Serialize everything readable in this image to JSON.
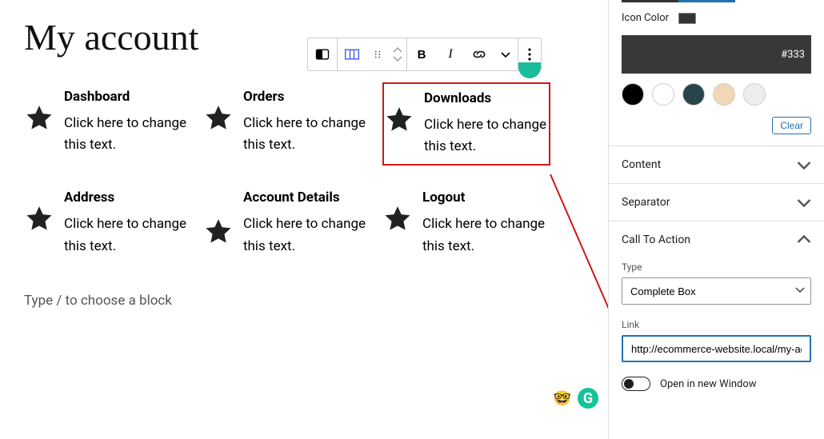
{
  "page": {
    "title": "My account",
    "block_prompt": "Type / to choose a block"
  },
  "toolbar": {
    "bold": "B",
    "italic": "I"
  },
  "cards": [
    {
      "title": "Dashboard",
      "text": "Click here to change this text.",
      "selected": false
    },
    {
      "title": "Orders",
      "text": "Click here to change this text.",
      "selected": false
    },
    {
      "title": "Downloads",
      "text": "Click here to change this text.",
      "selected": true
    },
    {
      "title": "Address",
      "text": "Click here to change this text.",
      "selected": false
    },
    {
      "title": "Account Details",
      "text": "Click here to change this text.",
      "selected": false
    },
    {
      "title": "Logout",
      "text": "Click here to change this text.",
      "selected": false
    }
  ],
  "sidebar": {
    "icon_color_label": "Icon Color",
    "hex_value": "#333",
    "swatches": [
      "#000000",
      "#ffffff",
      "#27444a",
      "#f2d7b6",
      "#eeeeee"
    ],
    "clear_label": "Clear",
    "panels": {
      "content": "Content",
      "separator": "Separator",
      "cta": "Call To Action"
    },
    "cta": {
      "type_label": "Type",
      "type_value": "Complete Box",
      "link_label": "Link",
      "link_value": "http://ecommerce-website.local/my-ac",
      "toggle_label": "Open in new Window"
    }
  }
}
